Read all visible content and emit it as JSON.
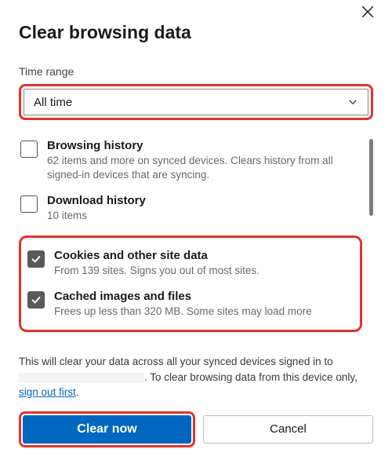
{
  "title": "Clear browsing data",
  "timeRange": {
    "label": "Time range",
    "value": "All time"
  },
  "options": [
    {
      "title": "Browsing history",
      "desc": "62 items and more on synced devices. Clears history from all signed-in devices that are syncing.",
      "checked": false
    },
    {
      "title": "Download history",
      "desc": "10 items",
      "checked": false
    },
    {
      "title": "Cookies and other site data",
      "desc": "From 139 sites. Signs you out of most sites.",
      "checked": true
    },
    {
      "title": "Cached images and files",
      "desc": "Frees up less than 320 MB. Some sites may load more",
      "checked": true
    }
  ],
  "footer": {
    "part1": "This will clear your data across all your synced devices signed in to ",
    "part2": ". To clear browsing data from this device only, ",
    "link": "sign out first",
    "part3": "."
  },
  "buttons": {
    "primary": "Clear now",
    "secondary": "Cancel"
  }
}
